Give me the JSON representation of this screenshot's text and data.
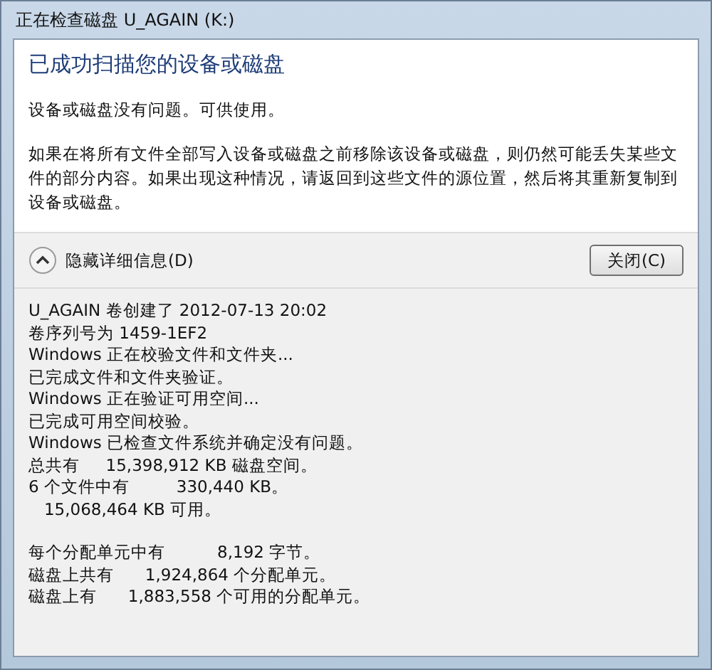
{
  "window": {
    "title": "正在检查磁盘 U_AGAIN (K:)"
  },
  "heading": "已成功扫描您的设备或磁盘",
  "paragraphs": [
    "设备或磁盘没有问题。可供使用。",
    "如果在将所有文件全部写入设备或磁盘之前移除该设备或磁盘，则仍然可能丢失某些文件的部分内容。如果出现这种情况，请返回到这些文件的源位置，然后将其重新复制到设备或磁盘。"
  ],
  "details_toggle": {
    "label": "隐藏详细信息(D)",
    "expanded": true
  },
  "close_button": "关闭(C)",
  "log_blocks": [
    [
      "U_AGAIN 卷创建了 2012-07-13 20:02",
      "卷序列号为 1459-1EF2",
      "Windows 正在校验文件和文件夹...",
      "已完成文件和文件夹验证。",
      "Windows 正在验证可用空间...",
      "已完成可用空间校验。",
      "Windows 已检查文件系统并确定没有问题。",
      "总共有     15,398,912 KB 磁盘空间。",
      "6 个文件中有         330,440 KB。",
      "   15,068,464 KB 可用。"
    ],
    [
      "每个分配单元中有          8,192 字节。",
      "磁盘上共有      1,924,864 个分配单元。",
      "磁盘上有      1,883,558 个可用的分配单元。"
    ]
  ]
}
